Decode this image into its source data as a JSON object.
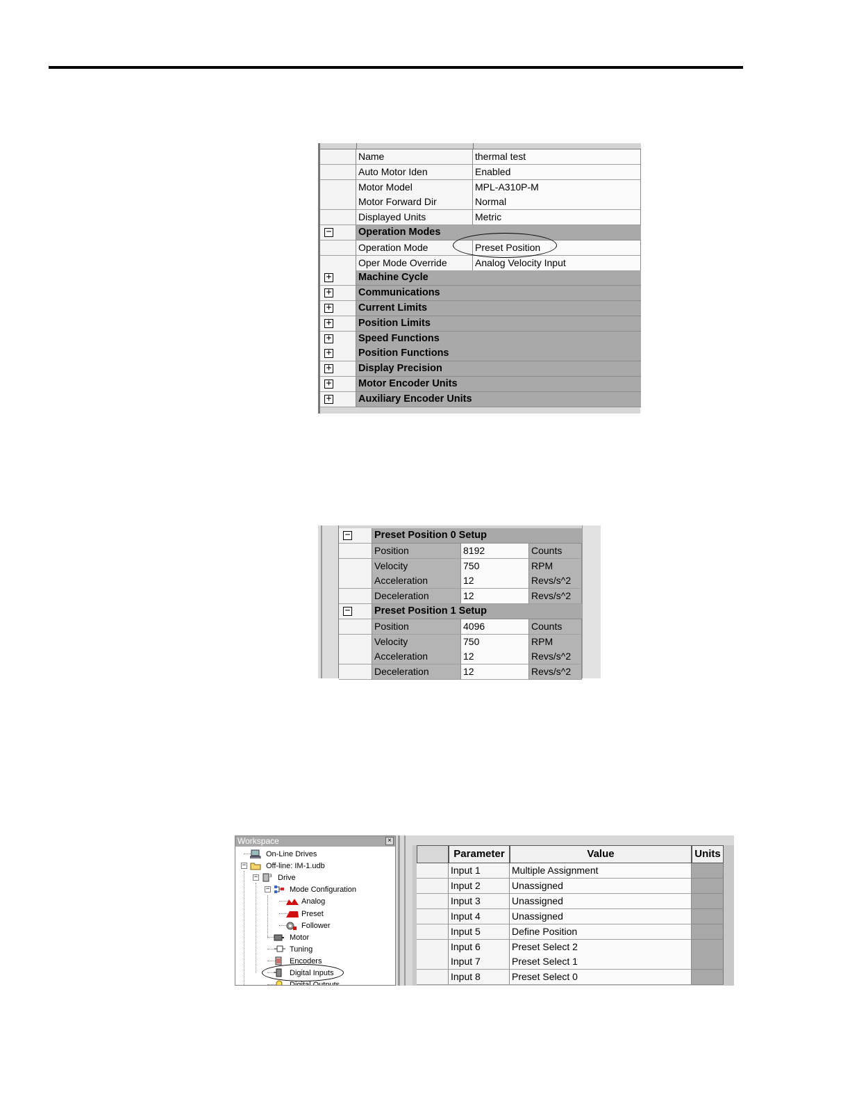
{
  "panel1": {
    "rows": [
      {
        "kind": "prop",
        "label": "Name",
        "value": "thermal test"
      },
      {
        "kind": "prop",
        "label": "Auto Motor Iden",
        "value": "Enabled"
      },
      {
        "kind": "prop",
        "label": "Motor Model",
        "value": "MPL-A310P-M"
      },
      {
        "kind": "prop",
        "label": "Motor Forward Dir",
        "value": "Normal"
      },
      {
        "kind": "prop",
        "label": "Displayed Units",
        "value": "Metric"
      },
      {
        "kind": "group",
        "label": "Operation Modes",
        "toggle": "−"
      },
      {
        "kind": "prop",
        "label": "Operation Mode",
        "value": "Preset Position"
      },
      {
        "kind": "prop",
        "label": "Oper Mode Override",
        "value": "Analog Velocity Input"
      },
      {
        "kind": "group",
        "label": "Machine Cycle",
        "toggle": "+"
      },
      {
        "kind": "group",
        "label": "Communications",
        "toggle": "+"
      },
      {
        "kind": "group",
        "label": "Current Limits",
        "toggle": "+"
      },
      {
        "kind": "group",
        "label": "Position Limits",
        "toggle": "+"
      },
      {
        "kind": "group",
        "label": "Speed Functions",
        "toggle": "+"
      },
      {
        "kind": "group",
        "label": "Position Functions",
        "toggle": "+"
      },
      {
        "kind": "group",
        "label": "Display Precision",
        "toggle": "+"
      },
      {
        "kind": "group",
        "label": "Motor Encoder Units",
        "toggle": "+"
      },
      {
        "kind": "group",
        "label": "Auxiliary Encoder Units",
        "toggle": "+"
      }
    ]
  },
  "panel2": {
    "rows": [
      {
        "kind": "group",
        "label": "Preset Position 0 Setup",
        "toggle": "−"
      },
      {
        "kind": "prop",
        "label": "Position",
        "value": "8192",
        "unit": "Counts"
      },
      {
        "kind": "prop",
        "label": "Velocity",
        "value": "750",
        "unit": "RPM"
      },
      {
        "kind": "prop",
        "label": "Acceleration",
        "value": "12",
        "unit": "Revs/s^2"
      },
      {
        "kind": "prop",
        "label": "Deceleration",
        "value": "12",
        "unit": "Revs/s^2"
      },
      {
        "kind": "group",
        "label": "Preset Position 1 Setup",
        "toggle": "−"
      },
      {
        "kind": "prop",
        "label": "Position",
        "value": "4096",
        "unit": "Counts"
      },
      {
        "kind": "prop",
        "label": "Velocity",
        "value": "750",
        "unit": "RPM"
      },
      {
        "kind": "prop",
        "label": "Acceleration",
        "value": "12",
        "unit": "Revs/s^2"
      },
      {
        "kind": "prop",
        "label": "Deceleration",
        "value": "12",
        "unit": "Revs/s^2"
      }
    ]
  },
  "workspace": {
    "title": "Workspace",
    "close": "×",
    "tree": [
      {
        "label": "On-Line Drives",
        "icon": "computer-icon",
        "expander": ""
      },
      {
        "label": "Off-line: IM-1.udb",
        "icon": "folder-icon",
        "expander": "−"
      },
      {
        "label": "Drive",
        "icon": "drive-icon",
        "expander": "−"
      },
      {
        "label": "Mode Configuration",
        "icon": "mode-config-icon",
        "expander": "−"
      },
      {
        "label": "Analog",
        "icon": "analog-icon",
        "expander": ""
      },
      {
        "label": "Preset",
        "icon": "preset-icon",
        "expander": ""
      },
      {
        "label": "Follower",
        "icon": "follower-icon",
        "expander": ""
      },
      {
        "label": "Motor",
        "icon": "motor-icon",
        "expander": ""
      },
      {
        "label": "Tuning",
        "icon": "tuning-icon",
        "expander": ""
      },
      {
        "label": "Encoders",
        "icon": "encoder-icon",
        "expander": ""
      },
      {
        "label": "Digital Inputs",
        "icon": "digital-input-icon",
        "expander": ""
      },
      {
        "label": "Digital Outputs",
        "icon": "digital-output-icon",
        "expander": ""
      }
    ]
  },
  "inputs_grid": {
    "headers": {
      "parameter": "Parameter",
      "value": "Value",
      "units": "Units"
    },
    "rows": [
      {
        "label": "Input 1",
        "value": "Multiple Assignment"
      },
      {
        "label": "Input 2",
        "value": "Unassigned"
      },
      {
        "label": "Input 3",
        "value": "Unassigned"
      },
      {
        "label": "Input 4",
        "value": "Unassigned"
      },
      {
        "label": "Input 5",
        "value": "Define Position"
      },
      {
        "label": "Input 6",
        "value": "Preset Select 2"
      },
      {
        "label": "Input 7",
        "value": "Preset Select 1"
      },
      {
        "label": "Input 8",
        "value": "Preset Select 0"
      }
    ]
  },
  "colors": {
    "group_row": "#a9a9a9",
    "value_cell": "#fbfbfb",
    "accent_red": "#d01010"
  }
}
